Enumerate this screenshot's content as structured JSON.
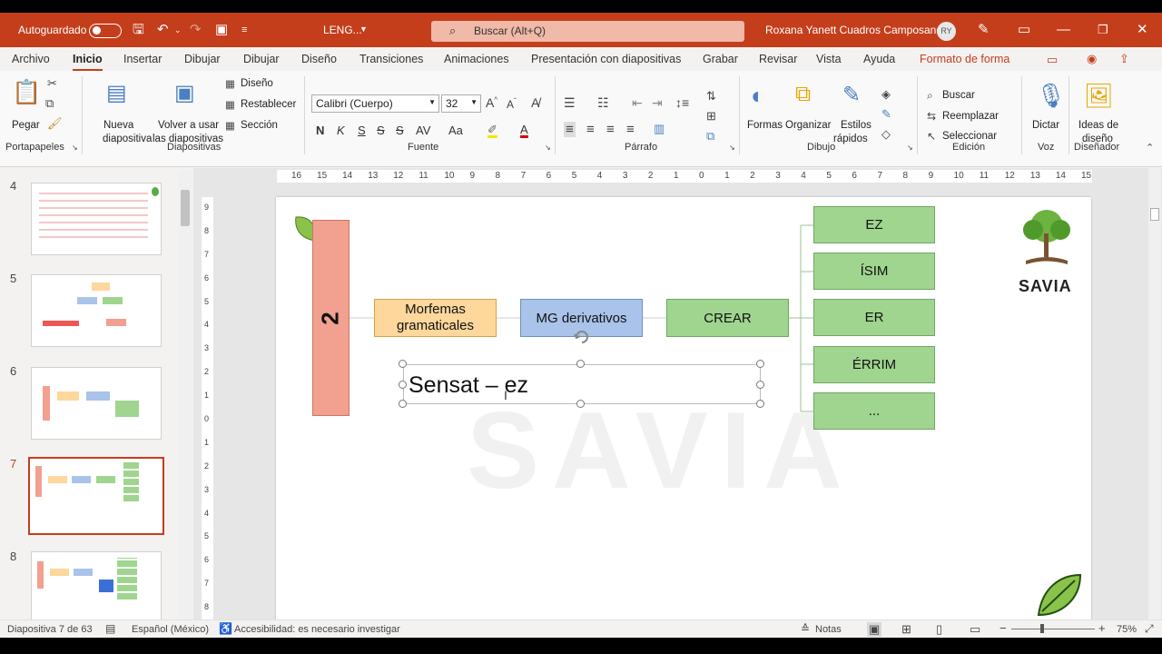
{
  "titlebar": {
    "autosave_label": "Autoguardado",
    "doc_name": "LENG...",
    "search_placeholder": "Buscar (Alt+Q)",
    "user_name": "Roxana Yanett Cuadros Camposano",
    "user_initials": "RY"
  },
  "tabs": [
    "Archivo",
    "Inicio",
    "Insertar",
    "Dibujar",
    "Dibujar",
    "Diseño",
    "Transiciones",
    "Animaciones",
    "Presentación con diapositivas",
    "Grabar",
    "Revisar",
    "Vista",
    "Ayuda",
    "Formato de forma"
  ],
  "ribbon": {
    "portapapeles": {
      "paste": "Pegar",
      "group": "Portapapeles"
    },
    "diapositivas": {
      "new_slide_1": "Nueva",
      "new_slide_2": "diapositiva",
      "reuse_1": "Volver a usar",
      "reuse_2": "las diapositivas",
      "layout": "Diseño",
      "reset": "Restablecer",
      "section": "Sección",
      "group": "Diapositivas"
    },
    "fuente": {
      "font_name": "Calibri (Cuerpo)",
      "font_size": "32",
      "bold": "N",
      "italic": "K",
      "underline": "S",
      "strike": "S",
      "group": "Fuente"
    },
    "parrafo": {
      "group": "Párrafo"
    },
    "dibujo": {
      "shapes": "Formas",
      "arrange": "Organizar",
      "styles_1": "Estilos",
      "styles_2": "rápidos",
      "group": "Dibujo"
    },
    "edicion": {
      "find": "Buscar",
      "replace": "Reemplazar",
      "select": "Seleccionar",
      "group": "Edición"
    },
    "voz": {
      "dictate": "Dictar",
      "group": "Voz"
    },
    "disenador": {
      "ideas_1": "Ideas de",
      "ideas_2": "diseño",
      "group": "Diseñador"
    }
  },
  "slides_pane": {
    "numbers": [
      "4",
      "5",
      "6",
      "7",
      "8"
    ],
    "selected": "7"
  },
  "slide": {
    "number_box": "2",
    "box_morfemas": "Morfemas gramaticales",
    "box_mg": "MG derivativos",
    "box_crear": "CREAR",
    "suffixes": [
      "EZ",
      "ÍSIM",
      "ER",
      "ÉRRIM",
      "..."
    ],
    "text_box": "Sensat – ez",
    "logo_text": "SAVIA",
    "watermark": "SAVIA"
  },
  "rulers": {
    "h_ticks": [
      "16",
      "15",
      "14",
      "13",
      "12",
      "11",
      "10",
      "9",
      "8",
      "7",
      "6",
      "5",
      "4",
      "3",
      "2",
      "1",
      "0",
      "1",
      "2",
      "3",
      "4",
      "5",
      "6",
      "7",
      "8",
      "9",
      "10",
      "11",
      "12",
      "13",
      "14",
      "15",
      "16"
    ],
    "v_ticks": [
      "9",
      "8",
      "7",
      "6",
      "5",
      "4",
      "3",
      "2",
      "1",
      "0",
      "1",
      "2",
      "3",
      "4",
      "5",
      "6",
      "7",
      "8"
    ]
  },
  "status": {
    "slide_info": "Diapositiva 7 de 63",
    "language": "Español (México)",
    "accessibility": "Accesibilidad: es necesario investigar",
    "notes": "Notas",
    "zoom": "75%"
  },
  "colors": {
    "accent": "#c43e1c",
    "number_box_fill": "#f2a08f",
    "morfemas_fill": "#fdd79b",
    "mg_fill": "#a9c3ea",
    "green_fill": "#9fd58f"
  }
}
